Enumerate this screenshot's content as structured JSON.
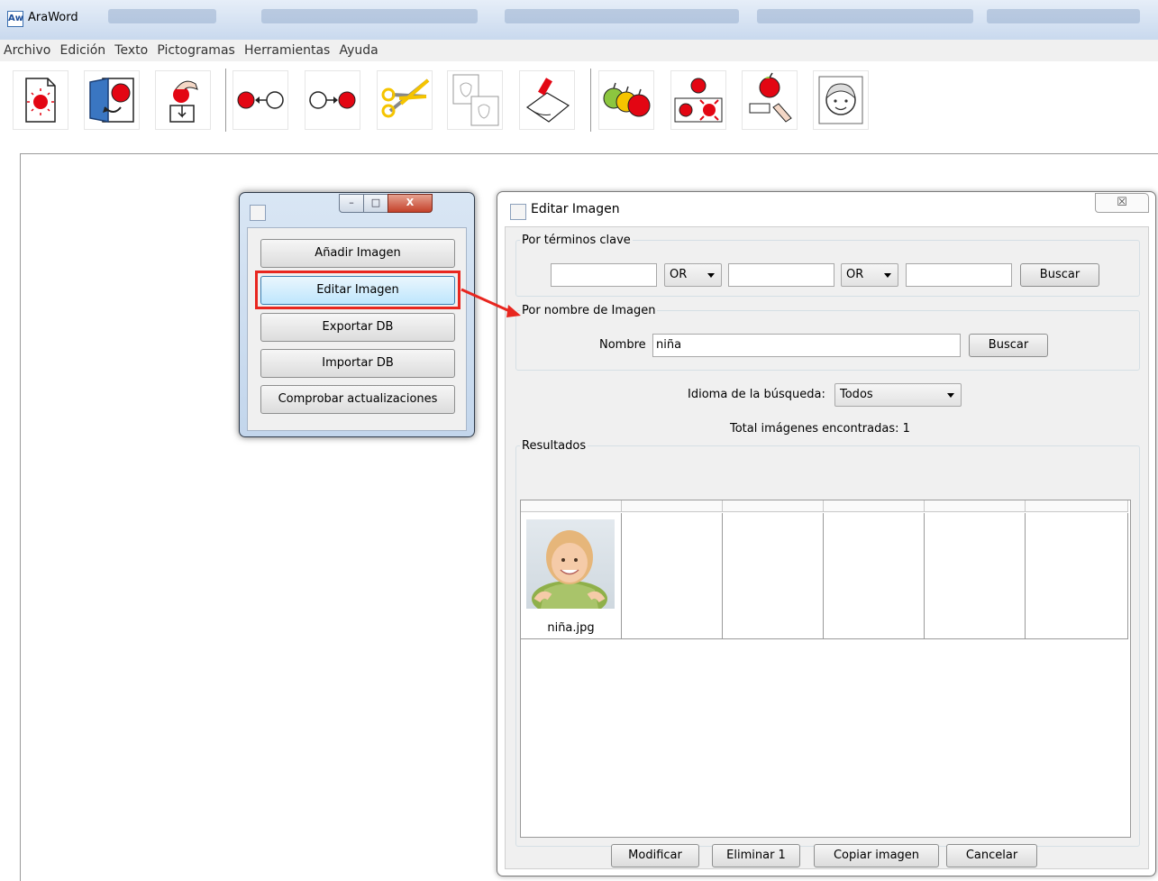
{
  "app": {
    "title": "AraWord",
    "icon_text": "Aw"
  },
  "menu": [
    "Archivo",
    "Edición",
    "Texto",
    "Pictogramas",
    "Herramientas",
    "Ayuda"
  ],
  "toolbar_icons": [
    "new-document-icon",
    "open-icon",
    "save-icon",
    "undo-icon",
    "redo-icon",
    "cut-icon",
    "copy-icon",
    "paste-icon",
    "pictogram-set-icon",
    "apply-pictogram-icon",
    "edit-pictogram-icon",
    "face-pictogram-icon"
  ],
  "admin_window": {
    "controls": {
      "minimize": "–",
      "maximize": "□",
      "close": "X"
    },
    "buttons": [
      "Añadir Imagen",
      "Editar Imagen",
      "Exportar DB",
      "Importar DB",
      "Comprobar actualizaciones"
    ],
    "selected_button": "Editar Imagen"
  },
  "dialog": {
    "title": "Editar Imagen",
    "close_glyph": "☒",
    "keyword_group": {
      "legend": "Por términos clave",
      "term1": "",
      "op1": "OR",
      "term2": "",
      "op2": "OR",
      "term3": "",
      "search_label": "Buscar"
    },
    "name_group": {
      "legend": "Por nombre de Imagen",
      "name_label": "Nombre",
      "name_value": "niña",
      "search_label": "Buscar"
    },
    "language": {
      "label": "Idioma de la búsqueda:",
      "value": "Todos"
    },
    "total": {
      "label": "Total imágenes encontradas:",
      "value": "1"
    },
    "results": {
      "legend": "Resultados",
      "items": [
        {
          "caption": "niña.jpg"
        }
      ]
    },
    "buttons": {
      "modify": "Modificar",
      "delete": "Eliminar 1",
      "copy": "Copiar imagen",
      "cancel": "Cancelar"
    }
  },
  "colors": {
    "highlight": "#e8261f",
    "selection": "#bee6fd"
  }
}
